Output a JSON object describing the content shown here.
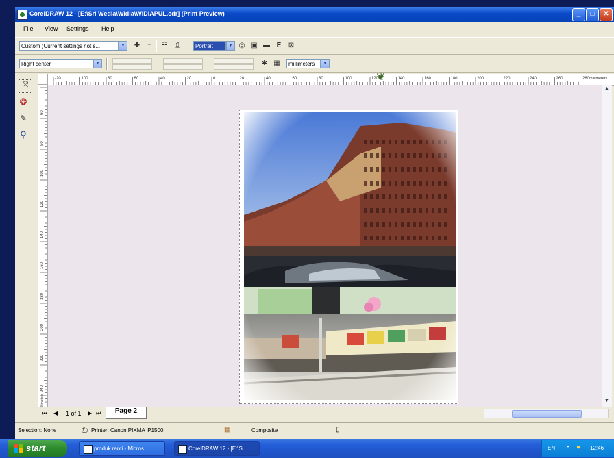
{
  "window": {
    "title": "CorelDRAW 12 - [E:\\Sri Wedia\\Widia\\WIDIAPUL.cdr] (Print Preview)",
    "controls": {
      "minimize": "_",
      "maximize": "□",
      "close": "✕"
    }
  },
  "menu": {
    "items": [
      "File",
      "View",
      "Settings",
      "Help"
    ]
  },
  "toolbar1": {
    "print_style": "Custom (Current settings not s...",
    "orientation": "Portrait"
  },
  "toolbar2": {
    "position": "Right center",
    "units": "millimeters"
  },
  "ruler": {
    "h_labels": [
      "-20",
      "100",
      "80",
      "60",
      "40",
      "20",
      "0",
      "20",
      "40",
      "60",
      "80",
      "100",
      "120",
      "140",
      "160",
      "180",
      "200",
      "220",
      "240",
      "260",
      "280"
    ],
    "h_unit": "millimeters",
    "v_labels": [
      "60",
      "80",
      "100",
      "120",
      "140",
      "160",
      "180",
      "200",
      "220",
      "240"
    ],
    "v_unit": "millimeters"
  },
  "page_nav": {
    "counter": "1 of 1",
    "tab": "Page 2"
  },
  "status": {
    "selection": "Selection: None",
    "printer": "Printer: Canon PIXMA iP1500",
    "composite": "Composite"
  },
  "taskbar": {
    "start": "start",
    "tasks": [
      "produk.ranti - Micros...",
      "CorelDRAW 12 - [E:\\S..."
    ],
    "lang": "EN",
    "clock": "12:46"
  },
  "colors": {
    "titlebar": "#0a49c8",
    "taskbar": "#245ed8",
    "start_green": "#2c8a2c",
    "canvas": "#ece6ec",
    "window_bg": "#ece9d8"
  }
}
